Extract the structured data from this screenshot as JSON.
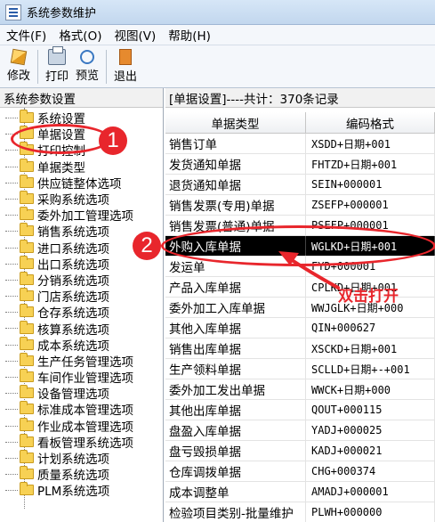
{
  "window": {
    "title": "系统参数维护"
  },
  "menu": [
    {
      "label": "文件(F)"
    },
    {
      "label": "格式(O)"
    },
    {
      "label": "视图(V)"
    },
    {
      "label": "帮助(H)"
    }
  ],
  "toolbar": {
    "edit_label": "修改",
    "print_label": "打印",
    "preview_label": "预览",
    "exit_label": "退出"
  },
  "left": {
    "header": "系统参数设置",
    "items": [
      "系统设置",
      "单据设置",
      "打印控制",
      "单据类型",
      "供应链整体选项",
      "采购系统选项",
      "委外加工管理选项",
      "销售系统选项",
      "进口系统选项",
      "出口系统选项",
      "分销系统选项",
      "门店系统选项",
      "仓存系统选项",
      "核算系统选项",
      "成本系统选项",
      "生产任务管理选项",
      "车间作业管理选项",
      "设备管理选项",
      "标准成本管理选项",
      "作业成本管理选项",
      "看板管理系统选项",
      "计划系统选项",
      "质量系统选项",
      "PLM系统选项"
    ]
  },
  "right": {
    "header": "[单据设置]----共计：370条记录",
    "columns": [
      "单据类型",
      "编码格式"
    ],
    "rows": [
      [
        "销售订单",
        "XSDD+日期+001"
      ],
      [
        "发货通知单据",
        "FHTZD+日期+001"
      ],
      [
        "退货通知单据",
        "SEIN+000001"
      ],
      [
        "销售发票(专用)单据",
        "ZSEFP+000001"
      ],
      [
        "销售发票(普通)单据",
        "PSEFP+000001"
      ],
      [
        "外购入库单据",
        "WGLKD+日期+001"
      ],
      [
        "发运单",
        "FYD+000001"
      ],
      [
        "产品入库单据",
        "CPLKD+日期+001"
      ],
      [
        "委外加工入库单据",
        "WWJGLK+日期+000"
      ],
      [
        "其他入库单据",
        "QIN+000627"
      ],
      [
        "销售出库单据",
        "XSCKD+日期+001"
      ],
      [
        "生产领料单据",
        "SCLLD+日期+-+001"
      ],
      [
        "委外加工发出单据",
        "WWCK+日期+000"
      ],
      [
        "其他出库单据",
        "QOUT+000115"
      ],
      [
        "盘盈入库单据",
        "YADJ+000025"
      ],
      [
        "盘亏毁损单据",
        "KADJ+000021"
      ],
      [
        "仓库调拨单据",
        "CHG+000374"
      ],
      [
        "成本调整单",
        "AMADJ+000001"
      ],
      [
        "检验项目类别-批量维护",
        "PLWH+000000"
      ]
    ],
    "selected_index": 5
  },
  "annotations": {
    "badge1": "1",
    "badge2": "2",
    "hint": "双击打开",
    "color": "#e8262c"
  }
}
